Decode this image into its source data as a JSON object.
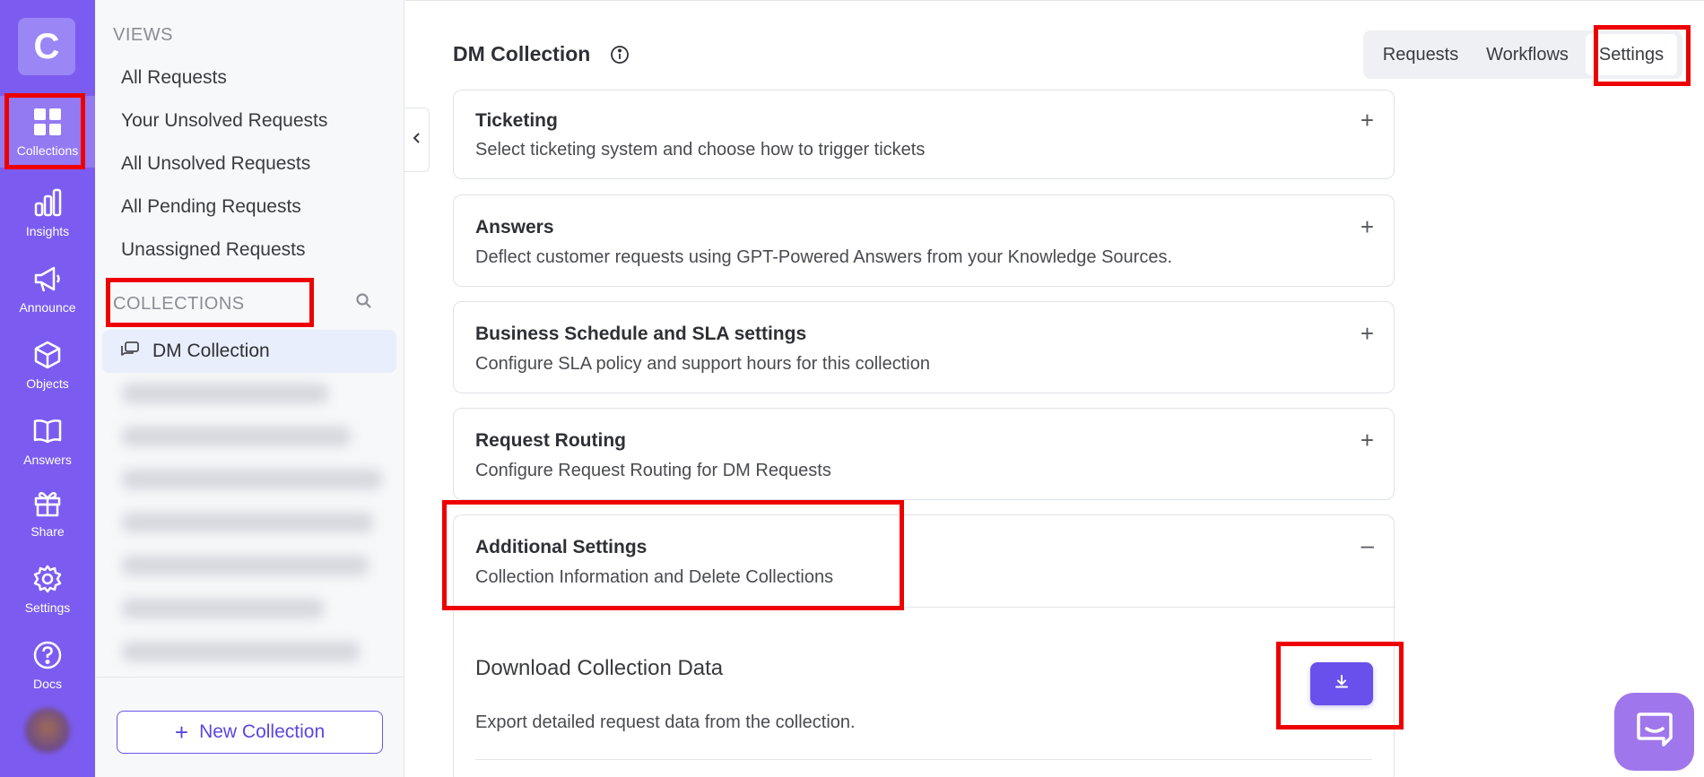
{
  "rail": {
    "logo": "C",
    "items": [
      {
        "label": "Collections",
        "icon": "grid-icon"
      },
      {
        "label": "Insights",
        "icon": "bar-chart-icon"
      },
      {
        "label": "Announce",
        "icon": "megaphone-icon"
      },
      {
        "label": "Objects",
        "icon": "cube-icon"
      },
      {
        "label": "Answers",
        "icon": "book-icon"
      },
      {
        "label": "Share",
        "icon": "gift-icon"
      },
      {
        "label": "Settings",
        "icon": "gear-icon"
      },
      {
        "label": "Docs",
        "icon": "help-circle-icon"
      }
    ],
    "accent": "#7c5cf0"
  },
  "sidebar": {
    "views_title": "VIEWS",
    "views": [
      "All Requests",
      "Your Unsolved Requests",
      "All Unsolved Requests",
      "All Pending Requests",
      "Unassigned Requests"
    ],
    "collections_title": "COLLECTIONS",
    "active_collection": "DM Collection",
    "new_collection": "New Collection"
  },
  "main": {
    "title": "DM Collection",
    "tabs": [
      "Requests",
      "Workflows",
      "Settings"
    ],
    "active_tab": "Settings",
    "sections": [
      {
        "title": "Ticketing",
        "desc": "Select ticketing system and choose how to trigger tickets",
        "toggle": "+"
      },
      {
        "title": "Answers",
        "desc": "Deflect customer requests using GPT-Powered Answers from your Knowledge Sources.",
        "toggle": "+"
      },
      {
        "title": "Business Schedule and SLA settings",
        "desc": "Configure SLA policy and support hours for this collection",
        "toggle": "+"
      },
      {
        "title": "Request Routing",
        "desc": "Configure Request Routing for DM Requests",
        "toggle": "+"
      },
      {
        "title": "Additional Settings",
        "desc": "Collection Information and Delete Collections",
        "toggle": "–"
      }
    ],
    "download": {
      "title": "Download Collection Data",
      "desc": "Export detailed request data from the collection."
    }
  },
  "colors": {
    "primary": "#6950ec",
    "highlight": "#ee0000"
  }
}
